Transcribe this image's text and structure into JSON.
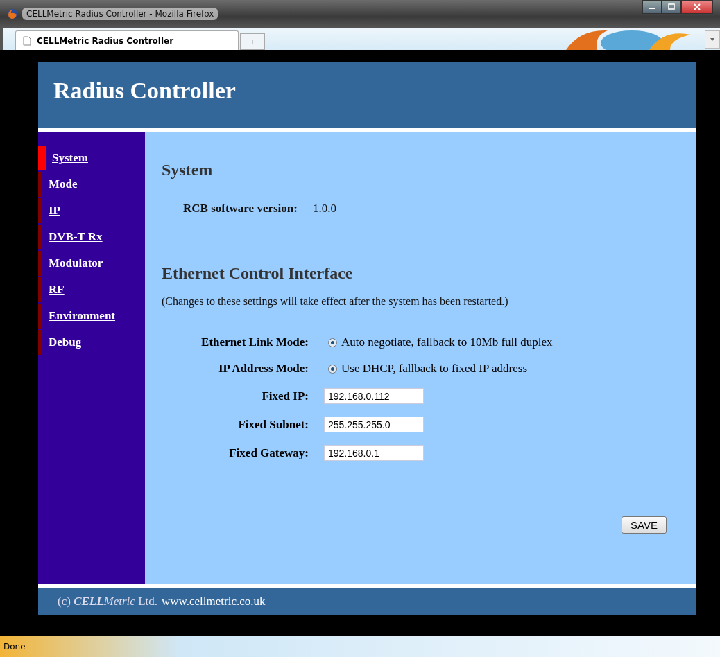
{
  "window": {
    "title": "CELLMetric Radius Controller - Mozilla Firefox"
  },
  "tabs": [
    {
      "label": "CELLMetric Radius Controller",
      "selected": true
    }
  ],
  "new_tab": "+",
  "page": {
    "title": "Radius Controller",
    "nav": [
      {
        "label": "System",
        "selected": true
      },
      {
        "label": "Mode",
        "selected": false
      },
      {
        "label": "IP",
        "selected": false
      },
      {
        "label": "DVB-T Rx",
        "selected": false
      },
      {
        "label": "Modulator",
        "selected": false
      },
      {
        "label": "RF",
        "selected": false
      },
      {
        "label": "Environment",
        "selected": false
      },
      {
        "label": "Debug",
        "selected": false
      }
    ],
    "system": {
      "heading": "System",
      "label": "RCB software version:",
      "value": "1.0.0"
    },
    "ethernet": {
      "heading": "Ethernet Control Interface",
      "note": "(Changes to these settings will take effect after the system has been restarted.)",
      "rows": [
        {
          "kind": "radio",
          "label": "Ethernet Link Mode:",
          "option": "Auto negotiate, fallback to 10Mb full duplex",
          "checked": true
        },
        {
          "kind": "radio",
          "label": "IP Address Mode:",
          "option": "Use DHCP, fallback to fixed IP address",
          "checked": true
        },
        {
          "kind": "input",
          "label": "Fixed IP:",
          "value": "192.168.0.112"
        },
        {
          "kind": "input",
          "label": "Fixed Subnet:",
          "value": "255.255.255.0"
        },
        {
          "kind": "input",
          "label": "Fixed Gateway:",
          "value": "192.168.0.1"
        }
      ]
    },
    "save": "SAVE",
    "footer": {
      "prefix": "(c) ",
      "brand_bold": "CELL",
      "brand_italic": "Metric",
      "suffix": " Ltd.",
      "link": "www.cellmetric.co.uk"
    }
  },
  "status_bar": "Done"
}
